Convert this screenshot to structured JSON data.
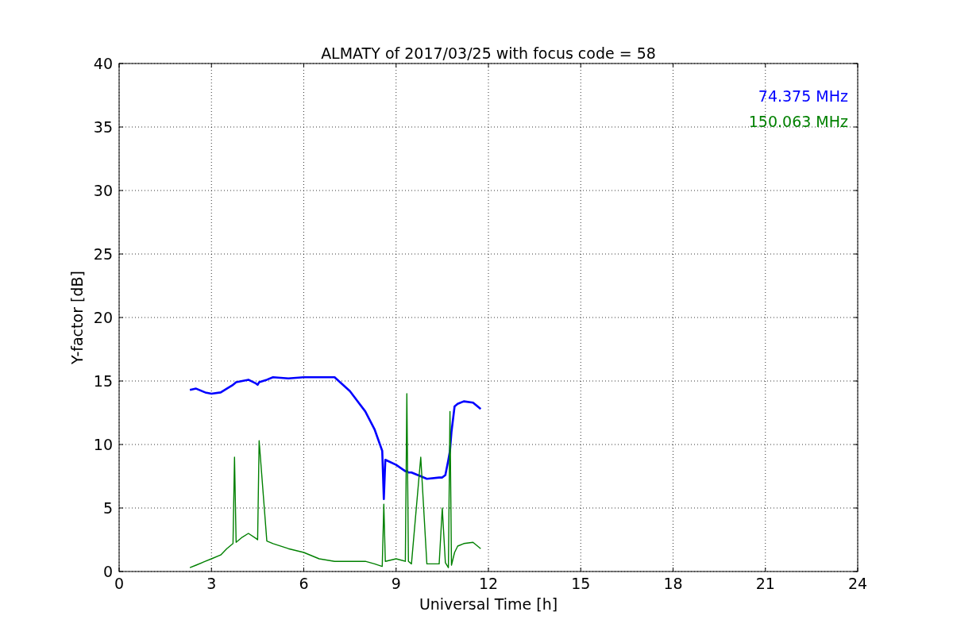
{
  "chart_data": {
    "type": "line",
    "title": "ALMATY of 2017/03/25 with focus code = 58",
    "xlabel": "Universal Time [h]",
    "ylabel": "Y-factor [dB]",
    "x": [
      2.3,
      2.5,
      2.8,
      3,
      3.3,
      3.5,
      3.7,
      3.75,
      3.8,
      4,
      4.2,
      4.45,
      4.5,
      4.55,
      4.8,
      5,
      5.5,
      6,
      6.5,
      7,
      7.5,
      8,
      8.3,
      8.55,
      8.6,
      8.65,
      9,
      9.3,
      9.35,
      9.4,
      9.5,
      9.8,
      10,
      10.4,
      10.5,
      10.6,
      10.7,
      10.75,
      10.8,
      10.9,
      11,
      11.2,
      11.5,
      11.75
    ],
    "series": [
      {
        "name": "74.375 MHz",
        "color": "#0000ff",
        "values": [
          14.3,
          14.4,
          14.1,
          14,
          14.1,
          14.4,
          14.7,
          14.8,
          14.9,
          15,
          15.1,
          14.8,
          14.7,
          14.9,
          15.1,
          15.3,
          15.2,
          15.3,
          15.3,
          15.3,
          14.2,
          12.6,
          11.2,
          9.5,
          5.7,
          8.8,
          8.4,
          7.9,
          7.9,
          7.8,
          7.8,
          7.5,
          7.3,
          7.4,
          7.4,
          7.6,
          8.8,
          9.5,
          11,
          13,
          13.2,
          13.4,
          13.3,
          12.8
        ]
      },
      {
        "name": "150.063 MHz",
        "color": "#008000",
        "values": [
          0.3,
          0.5,
          0.8,
          1,
          1.3,
          1.8,
          2.2,
          9,
          2.3,
          2.7,
          3,
          2.6,
          2.5,
          10.3,
          2.4,
          2.2,
          1.8,
          1.5,
          1,
          0.8,
          0.8,
          0.8,
          0.6,
          0.4,
          5.3,
          0.8,
          1,
          0.8,
          14,
          0.8,
          0.6,
          9,
          0.6,
          0.6,
          5,
          0.7,
          0.3,
          12.6,
          0.5,
          1.5,
          2,
          2.2,
          2.3,
          1.8
        ]
      }
    ],
    "xlim": [
      0,
      24
    ],
    "ylim": [
      0,
      40
    ],
    "xticks": [
      0,
      3,
      6,
      9,
      12,
      15,
      18,
      21,
      24
    ],
    "yticks": [
      0,
      5,
      10,
      15,
      20,
      25,
      30,
      35,
      40
    ],
    "grid": true
  }
}
